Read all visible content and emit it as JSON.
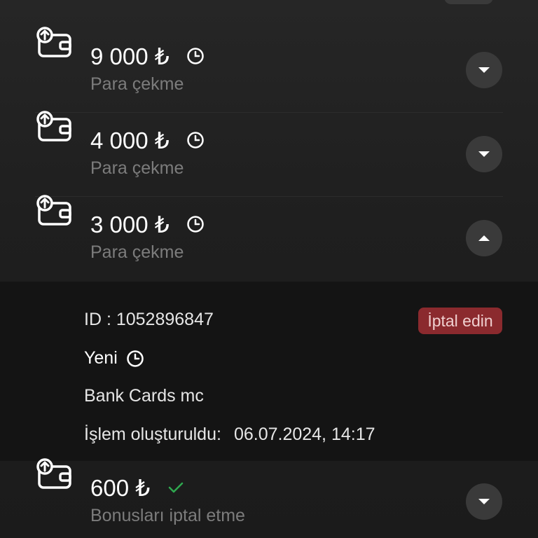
{
  "transactions": [
    {
      "amount": "9 000 ₺",
      "type": "Para çekme",
      "status": "pending",
      "expanded": false
    },
    {
      "amount": "4 000 ₺",
      "type": "Para çekme",
      "status": "pending",
      "expanded": false
    },
    {
      "amount": "3 000 ₺",
      "type": "Para çekme",
      "status": "pending",
      "expanded": true
    },
    {
      "amount": "600 ₺",
      "type": "Bonusları iptal etme",
      "status": "completed",
      "expanded": false
    }
  ],
  "details": {
    "id_text": "ID : 1052896847",
    "cancel_label": "İptal edin",
    "status_label": "Yeni",
    "method": "Bank Cards mc",
    "created_label": "İşlem oluşturuldu:",
    "created_value": "06.07.2024, 14:17"
  },
  "colors": {
    "background": "#1c1c1c",
    "secondary_text": "#7c7c7c",
    "cancel_button": "#8b2a2e",
    "success_check": "#2fa84f",
    "toggle_button": "#3a3a3a"
  },
  "icons": {
    "transaction": "wallet-upload-icon",
    "pending": "clock-icon",
    "completed": "check-icon",
    "collapsed": "chevron-down-icon",
    "expanded": "chevron-up-icon"
  }
}
